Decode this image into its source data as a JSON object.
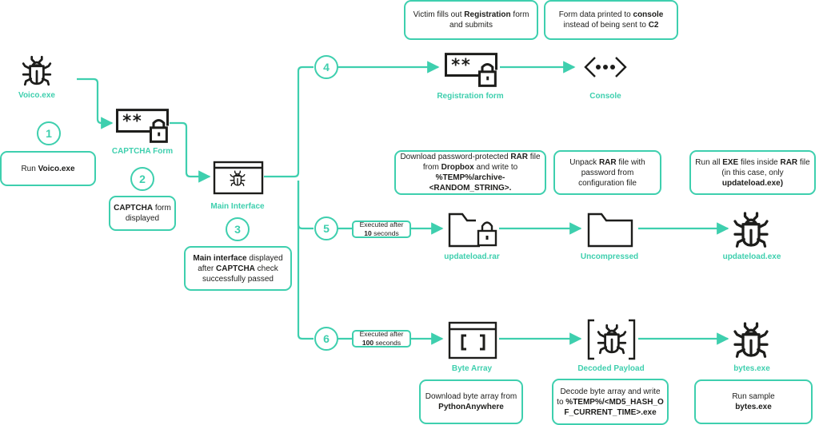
{
  "colors": {
    "accent": "#3ecfae",
    "ink": "#1d1d1b"
  },
  "nodes": {
    "voico": {
      "label": "Voico.exe",
      "icon": "bug-icon"
    },
    "captcha": {
      "label": "CAPTCHA Form",
      "icon": "password-lock-icon"
    },
    "main": {
      "label": "Main Interface",
      "icon": "window-bug-icon"
    },
    "registration": {
      "label": "Registration form",
      "icon": "password-lock-icon"
    },
    "console": {
      "label": "Console",
      "icon": "code-ellipsis-icon"
    },
    "rar": {
      "label": "updateload.rar",
      "icon": "locked-folder-icon"
    },
    "uncompressed": {
      "label": "Uncompressed",
      "icon": "folder-icon"
    },
    "updateload_exe": {
      "label": "updateload.exe",
      "icon": "bug-icon"
    },
    "byte_array": {
      "label": "Byte Array",
      "icon": "window-brackets-icon"
    },
    "decoded": {
      "label": "Decoded Payload",
      "icon": "bracket-bug-icon"
    },
    "bytes_exe": {
      "label": "bytes.exe",
      "icon": "bug-icon"
    }
  },
  "steps": [
    "1",
    "2",
    "3",
    "4",
    "5",
    "6"
  ],
  "delays": {
    "s5": {
      "pre": "Executed after",
      "num": "10",
      "post": " seconds"
    },
    "s6": {
      "pre": "Executed after",
      "num": "100",
      "post": " seconds"
    }
  },
  "notes": {
    "n1": {
      "a": "Run ",
      "b": "Voico.exe"
    },
    "n2": {
      "b": "CAPTCHA",
      "a": " form displayed"
    },
    "n3": {
      "b1": "Main interface",
      "a1": " displayed after ",
      "b2": "CAPTCHA",
      "a2": " check successfully passed"
    },
    "n4a": {
      "a1": "Victim fills out ",
      "b1": "Registration",
      "a2": " form and submits"
    },
    "n4b": {
      "a1": "Form data printed to ",
      "b1": "console",
      "a2": " instead of being sent to ",
      "b2": "C2"
    },
    "n5a": {
      "a1": "Download password-protected ",
      "b1": "RAR",
      "a2": " file from ",
      "b2": "Dropbox",
      "a3": " and write to ",
      "b3": "%TEMP%/archive-<RANDOM_STRING>."
    },
    "n5b": {
      "a1": "Unpack ",
      "b1": "RAR",
      "a2": " file with password from configuration file"
    },
    "n5c": {
      "a1": "Run all ",
      "b1": "EXE",
      "a2": " files inside ",
      "b2": "RAR",
      "a3": " file (in this case, only ",
      "b3": "updateload.exe)"
    },
    "n6a": {
      "a1": "Download byte array from ",
      "b1": "PythonAnywhere"
    },
    "n6b": {
      "a1": "Decode byte array and write to ",
      "b1": "%TEMP%/<MD5_HASH_OF_CURRENT_TIME>.exe"
    },
    "n6c": {
      "a1": "Run sample ",
      "b1": "bytes.exe"
    }
  }
}
